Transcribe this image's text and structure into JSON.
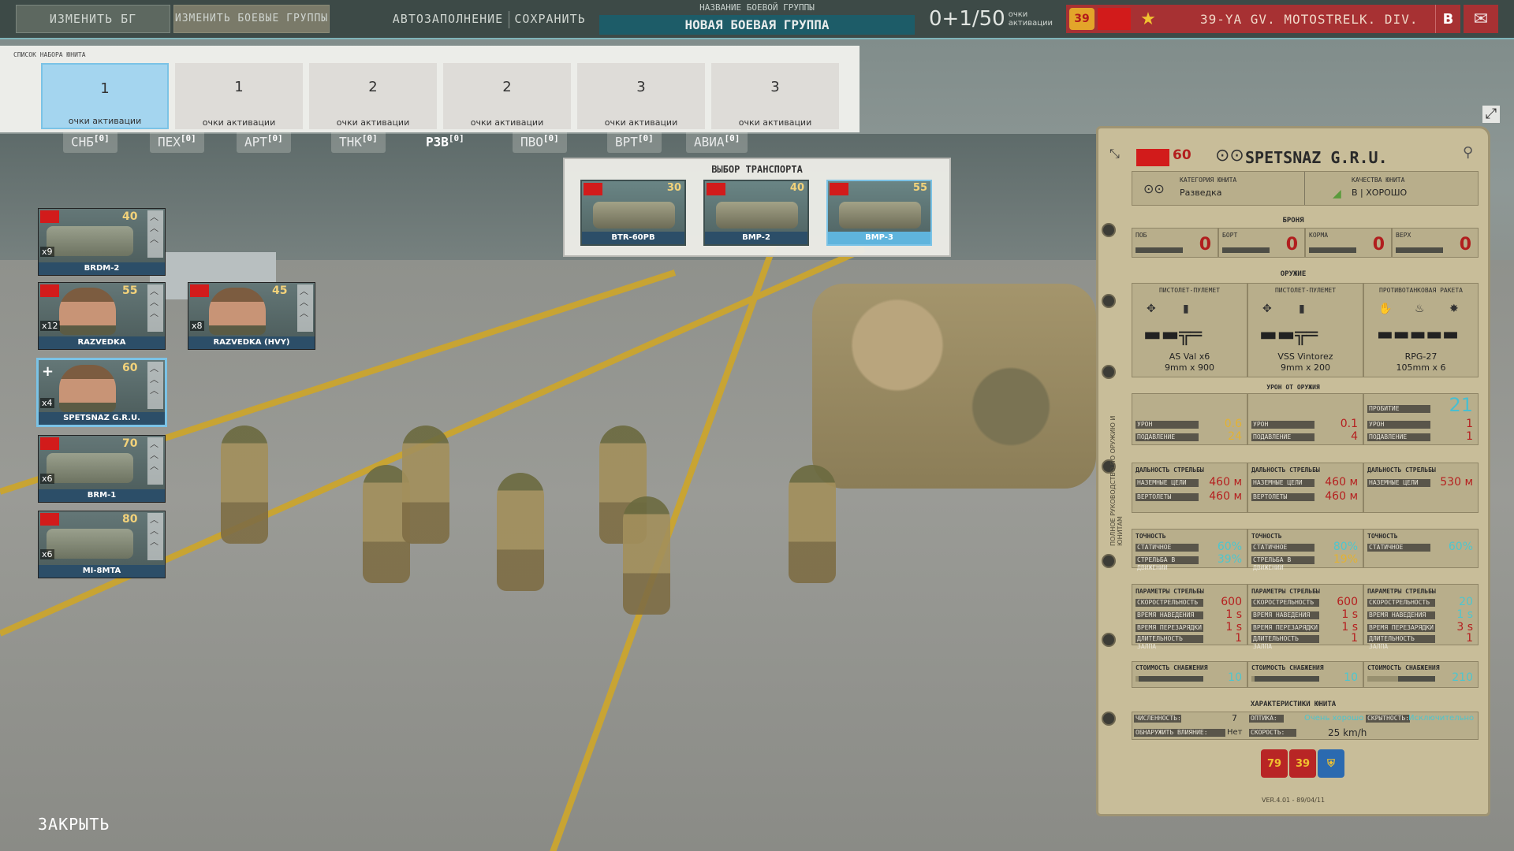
{
  "topbar": {
    "edit_bg": "ИЗМЕНИТЬ БГ",
    "edit_bgs": "ИЗМЕНИТЬ БОЕВЫЕ ГРУППЫ",
    "autofill": "АВТОЗАПОЛНЕНИЕ",
    "save": "СОХРАНИТЬ",
    "bg_name_label": "НАЗВАНИЕ БОЕВОЙ ГРУППЫ",
    "bg_name_value": "НОВАЯ БОЕВАЯ ГРУППА",
    "points_value": "0+1/50",
    "points_label_1": "очки",
    "points_label_2": "активации",
    "division_badge": "39",
    "division_name": "39-YA GV. MOTOSTRELK. DIV.",
    "b_button": "B",
    "mail_icon": "envelope-icon"
  },
  "unit_set": {
    "title": "СПИСОК НАБОРА ЮНИТА",
    "cards": [
      {
        "num": "1",
        "label": "очки активации"
      },
      {
        "num": "1",
        "label": "очки активации"
      },
      {
        "num": "2",
        "label": "очки активации"
      },
      {
        "num": "2",
        "label": "очки активации"
      },
      {
        "num": "3",
        "label": "очки активации"
      },
      {
        "num": "3",
        "label": "очки активации"
      }
    ]
  },
  "tabs": [
    {
      "label": "СНБ",
      "count": "[0]"
    },
    {
      "label": "ПЕХ",
      "count": "[0]"
    },
    {
      "label": "АРТ",
      "count": "[0]"
    },
    {
      "label": "ТНК",
      "count": "[0]"
    },
    {
      "label": "РЗВ",
      "count": "[0]"
    },
    {
      "label": "ПВО",
      "count": "[0]"
    },
    {
      "label": "ВРТ",
      "count": "[0]"
    },
    {
      "label": "АВИА",
      "count": "[0]"
    }
  ],
  "units": [
    {
      "name": "BRDM-2",
      "points": "40",
      "count": "x9",
      "group": "[2]"
    },
    {
      "name": "RAZVEDKA",
      "points": "55",
      "count": "x12",
      "group": "[4]"
    },
    {
      "name": "RAZVEDKA (HVY)",
      "points": "45",
      "count": "x8",
      "group": ""
    },
    {
      "name": "SPETSNAZ G.R.U.",
      "points": "60",
      "count": "x4",
      "group": "[2]"
    },
    {
      "name": "BRM-1",
      "points": "70",
      "count": "x6",
      "group": "[2]"
    },
    {
      "name": "MI-8MTA",
      "points": "80",
      "count": "x6",
      "group": ""
    }
  ],
  "transport": {
    "title": "ВЫБОР ТРАНСПОРТА",
    "options": [
      {
        "name": "BTR-60PB",
        "points": "30"
      },
      {
        "name": "BMP-2",
        "points": "40"
      },
      {
        "name": "BMP-3",
        "points": "55"
      }
    ]
  },
  "close": "ЗАКРЫТЬ",
  "info": {
    "points": "60",
    "name": "SPETSNAZ G.R.U.",
    "category_label": "КАТЕГОРИЯ ЮНИТА",
    "category_value": "Разведка",
    "quality_label": "КАЧЕСТВА ЮНИТА",
    "quality_value": "B | ХОРОШО",
    "armor_title": "БРОНЯ",
    "armor": [
      {
        "label": "ПОБ",
        "value": "0"
      },
      {
        "label": "БОРТ",
        "value": "0"
      },
      {
        "label": "КОРМА",
        "value": "0"
      },
      {
        "label": "ВЕРХ",
        "value": "0"
      }
    ],
    "weapons_title": "ОРУЖИЕ",
    "weapons": [
      {
        "type": "ПИСТОЛЕТ-ПУЛЕМЕТ",
        "name": "AS Val x6",
        "ammo": "9mm x 900"
      },
      {
        "type": "ПИСТОЛЕТ-ПУЛЕМЕТ",
        "name": "VSS Vintorez",
        "ammo": "9mm x 200"
      },
      {
        "type": "ПРОТИВОТАНКОВАЯ РАКЕТА",
        "name": "RPG-27",
        "ammo": "105mm x 6"
      }
    ],
    "damage_title": "Урон от оружия",
    "damage": [
      {
        "a_label": "УРОН",
        "a": "0.6",
        "b_label": "ПОДАВЛЕНИЕ",
        "b": "24"
      },
      {
        "a_label": "УРОН",
        "a": "0.1",
        "b_label": "ПОДАВЛЕНИЕ",
        "b": "4"
      },
      {
        "top_label": "ПРОБИТИЕ",
        "top": "21",
        "a_label": "УРОН",
        "a": "1",
        "b_label": "ПОДАВЛЕНИЕ",
        "b": "1"
      }
    ],
    "range_title": "ДАЛЬНОСТЬ СТРЕЛЬБЫ",
    "ranges": [
      {
        "a_label": "НАЗЕМНЫЕ ЦЕЛИ",
        "a": "460 м",
        "b_label": "ВЕРТОЛЕТЫ",
        "b": "460 м"
      },
      {
        "a_label": "НАЗЕМНЫЕ ЦЕЛИ",
        "a": "460 м",
        "b_label": "ВЕРТОЛЕТЫ",
        "b": "460 м"
      },
      {
        "a_label": "НАЗЕМНЫЕ ЦЕЛИ",
        "a": "530 м"
      }
    ],
    "acc_title": "ТОЧНОСТЬ",
    "accuracy": [
      {
        "a_label": "СТАТИЧНОЕ",
        "a": "60%",
        "b_label": "СТРЕЛЬБА В ДВИЖЕНИИ",
        "b": "39%"
      },
      {
        "a_label": "СТАТИЧНОЕ",
        "a": "80%",
        "b_label": "СТРЕЛЬБА В ДВИЖЕНИИ",
        "b": "19%"
      },
      {
        "a_label": "СТАТИЧНОЕ",
        "a": "60%"
      }
    ],
    "fire_title": "ПАРАМЕТРЫ СТРЕЛЬБЫ",
    "fire_labels": [
      "СКОРОСТРЕЛЬНОСТЬ",
      "ВРЕМЯ НАВЕДЕНИЯ",
      "ВРЕМЯ ПЕРЕЗАРЯДКИ",
      "ДЛИТЕЛЬНОСТЬ ЗАЛПА"
    ],
    "fire": [
      [
        "600",
        "1 s",
        "1 s",
        "1"
      ],
      [
        "600",
        "1 s",
        "1 s",
        "1"
      ],
      [
        "20",
        "1 s",
        "3 s",
        "1"
      ]
    ],
    "supply_title": "СТОИМОСТЬ СНАБЖЕНИЯ",
    "supply": [
      "10",
      "10",
      "210"
    ],
    "char_title": "ХАРАКТЕРИСТИКИ ЮНИТА",
    "char": {
      "strength_label": "ЧИСЛЕННОСТЬ:",
      "strength": "7",
      "optics_label": "ОПТИКА:",
      "optics": "Очень хорошо",
      "stealth_label": "СКРЫТНОСТЬ:",
      "stealth": "Исключительно",
      "detect_label": "ОБНАРУЖИТЬ ВЛИЯНИЕ:",
      "detect": "Нет",
      "speed_label": "СКОРОСТЬ:",
      "speed": "25 km/h"
    },
    "badges": [
      "79",
      "39"
    ],
    "side_note": "ПОЛНОЕ РУКОВОДСТВО ПО ОРУЖИЮ И ЮНИТАМ",
    "version": "VER.4.01 - 89/04/11"
  },
  "colors": {
    "accent_blue": "#7bc3e6",
    "soviet_red": "#d21b1b",
    "panel_beige": "#c8bd99",
    "value_red": "#b51f1f",
    "value_yellow": "#e3b233",
    "value_cyan": "#4dc6cf"
  }
}
